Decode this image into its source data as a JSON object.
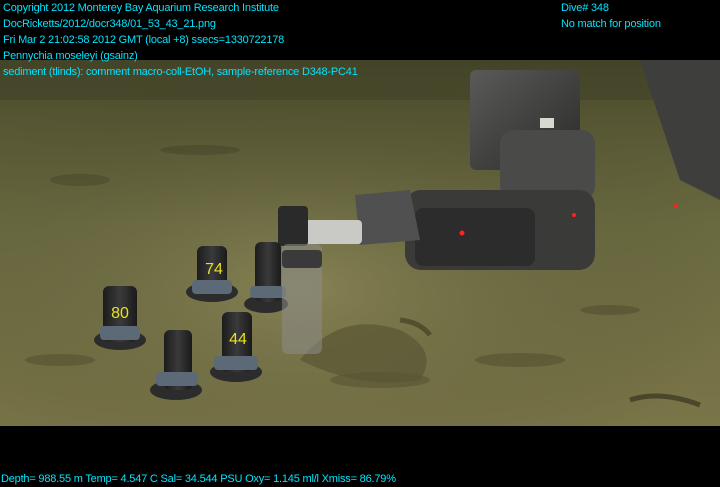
{
  "overlay": {
    "copyright": "Copyright 2012 Monterey Bay Aquarium Research Institute",
    "filename": "DocRicketts/2012/docr348/01_53_43_21.png",
    "timestamp": "Fri Mar  2 21:02:58 2012 GMT (local +8)  ssecs=1330722178",
    "species": "Pennychia moseleyi (gsainz)",
    "annotation": "sediment (tlinds): comment macro-coll-EtOH, sample-reference D348-PC41",
    "dive": "Dive# 348",
    "position": "No match for position",
    "telemetry": "Depth= 988.55 m  Temp= 4.547 C  Sal= 34.544 PSU  Oxy= 1.145 ml/l  Xmiss= 86.79%"
  },
  "scene": {
    "core_labels": [
      "80",
      "74",
      "44"
    ],
    "colors": {
      "overlay_text": "#00e5ff",
      "seafloor": "#6b6a3f",
      "robot_arm": "#3d3d3d",
      "laser": "#ff2020"
    }
  }
}
